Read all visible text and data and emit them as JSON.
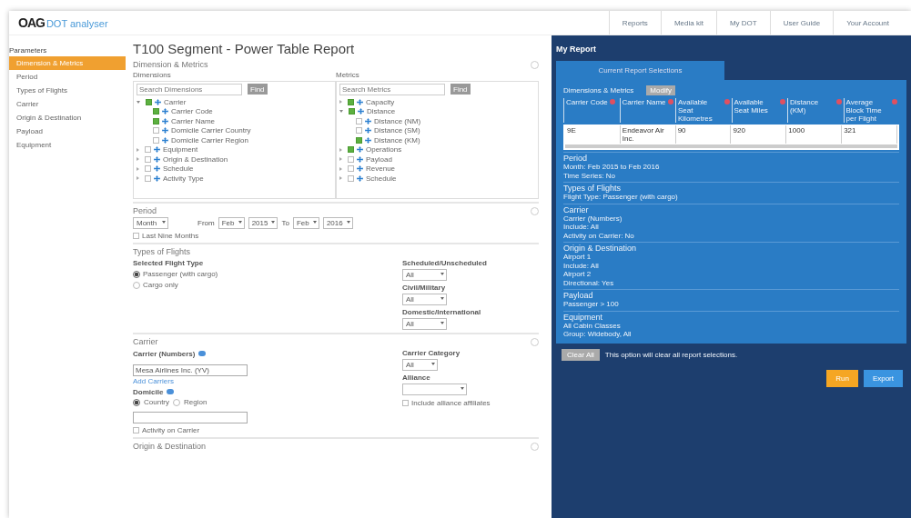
{
  "header": {
    "logo_mark": "OAG",
    "logo_text": "DOT analyser",
    "nav": [
      "Reports",
      "Media kit",
      "My DOT",
      "User Guide",
      "Your Account"
    ]
  },
  "sidebar": {
    "title": "Parameters",
    "items": [
      {
        "label": "Dimension & Metrics",
        "selected": true
      },
      {
        "label": "Period",
        "selected": false
      },
      {
        "label": "Types of Flights",
        "selected": false
      },
      {
        "label": "Carrier",
        "selected": false
      },
      {
        "label": "Origin & Destination",
        "selected": false
      },
      {
        "label": "Payload",
        "selected": false
      },
      {
        "label": "Equipment",
        "selected": false
      }
    ]
  },
  "page_title": "T100 Segment - Power Table Report",
  "dimensions_metrics": {
    "title": "Dimension & Metrics",
    "trees": [
      {
        "label": "Dimensions",
        "search_placeholder": "Search Dimensions",
        "button": "Find",
        "items": [
          {
            "label": "Carrier",
            "checked": true,
            "expanded": true,
            "children": [
              {
                "label": "Carrier Code",
                "checked": true
              },
              {
                "label": "Carrier Name",
                "checked": true
              },
              {
                "label": "Domicile Carrier Country",
                "checked": false
              },
              {
                "label": "Domicile Carrier Region",
                "checked": false
              }
            ]
          },
          {
            "label": "Equipment",
            "checked": false,
            "expanded": false
          },
          {
            "label": "Origin & Destination",
            "checked": false,
            "expanded": false
          },
          {
            "label": "Schedule",
            "checked": false,
            "expanded": false
          },
          {
            "label": "Activity Type",
            "checked": false,
            "expanded": false
          }
        ]
      },
      {
        "label": "Metrics",
        "search_placeholder": "Search Metrics",
        "button": "Find",
        "items": [
          {
            "label": "Capacity",
            "checked": true,
            "expanded": false
          },
          {
            "label": "Distance",
            "checked": true,
            "expanded": true,
            "children": [
              {
                "label": "Distance (NM)",
                "checked": false
              },
              {
                "label": "Distance (SM)",
                "checked": false
              },
              {
                "label": "Distance (KM)",
                "checked": true
              }
            ]
          },
          {
            "label": "Operations",
            "checked": true,
            "expanded": false
          },
          {
            "label": "Payload",
            "checked": false,
            "expanded": false
          },
          {
            "label": "Revenue",
            "checked": false,
            "expanded": false
          },
          {
            "label": "Schedule",
            "checked": false,
            "expanded": false
          }
        ]
      }
    ]
  },
  "period": {
    "title": "Period",
    "granularity": "Month",
    "from_label": "From",
    "from_month": "Feb",
    "from_year": "2015",
    "to_label": "To",
    "to_month": "Feb",
    "to_year": "2016",
    "option": {
      "label": "Last Nine Months",
      "checked": false
    }
  },
  "types_of_flights": {
    "title": "Types of Flights",
    "flight_type_label": "Selected Flight Type",
    "options": [
      {
        "label": "Passenger (with cargo)",
        "selected": true
      },
      {
        "label": "Cargo only",
        "selected": false
      }
    ],
    "filters": [
      {
        "label": "Scheduled/Unscheduled",
        "value": "All"
      },
      {
        "label": "Civil/Military",
        "value": "All"
      },
      {
        "label": "Domestic/International",
        "value": "All"
      }
    ]
  },
  "carrier": {
    "title": "Carrier",
    "field_label": "Carrier (Numbers)",
    "field_value": "Mesa Airlines Inc. (YV)",
    "link": "Add Carriers",
    "domicile_label": "Domicile",
    "domicile_options": [
      {
        "label": "Country",
        "selected": true
      },
      {
        "label": "Region",
        "selected": false
      }
    ],
    "activity": {
      "label": "Activity on Carrier",
      "checked": false
    },
    "category": {
      "label": "Carrier Category",
      "value": "All"
    },
    "alliance_label": "Alliance",
    "alliance_option": {
      "label": "Include alliance affiliates",
      "checked": false
    }
  },
  "next_section_title": "Origin & Destination",
  "report": {
    "title": "My Report",
    "tabs": [
      {
        "label": "Current Report Selections",
        "selected": true
      }
    ],
    "dm_label": "Dimensions & Metrics",
    "modify": "Modify",
    "columns": [
      "Carrier Code",
      "Carrier Name",
      "Available Seat Kilometres",
      "Available Seat Miles",
      "Distance (KM)",
      "Average Block Time per Flight"
    ],
    "row": [
      "9E",
      "Endeavor Air Inc.",
      "90",
      "920",
      "1000",
      "321"
    ],
    "sections": [
      {
        "title": "Period",
        "lines": [
          "Month: Feb 2015 to Feb 2016",
          "Time Series: No"
        ]
      },
      {
        "title": "Types of Flights",
        "lines": [
          "Flight Type: Passenger (with cargo)"
        ]
      },
      {
        "title": "Carrier",
        "lines": [
          "Carrier (Numbers)",
          "Include: All",
          "Activity on Carrier: No"
        ]
      },
      {
        "title": "Origin & Destination",
        "lines": [
          "Airport 1",
          "Include: All",
          "Airport 2",
          "Directional: Yes"
        ]
      },
      {
        "title": "Payload",
        "lines": [
          "Passenger > 100"
        ]
      },
      {
        "title": "Equipment",
        "lines": [
          "All Cabin Classes",
          "Group: Widebody, All"
        ]
      }
    ],
    "clear_button": "Clear All",
    "clear_note": "This option will clear all report selections.",
    "run": "Run",
    "export": "Export"
  }
}
